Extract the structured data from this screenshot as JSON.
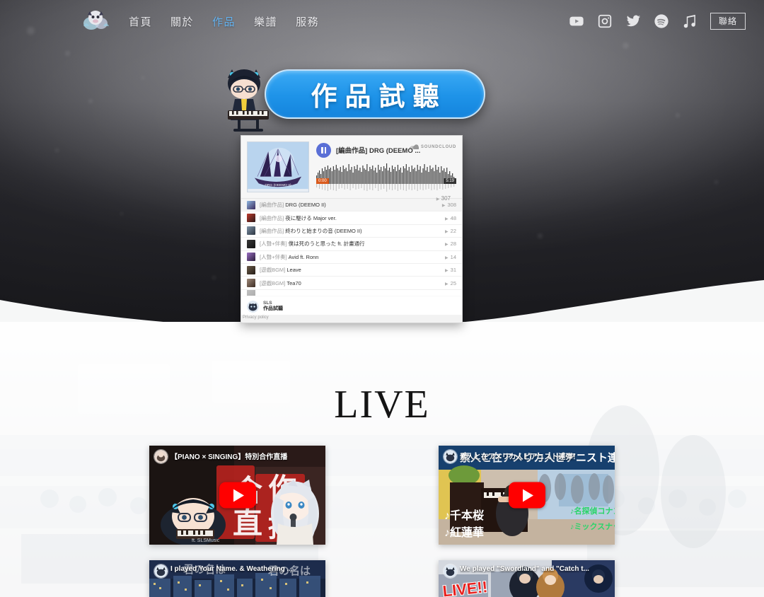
{
  "nav": {
    "logo_alt": "SLS logo",
    "links": [
      {
        "label": "首頁",
        "active": false
      },
      {
        "label": "關於",
        "active": false
      },
      {
        "label": "作品",
        "active": true
      },
      {
        "label": "樂譜",
        "active": false
      },
      {
        "label": "服務",
        "active": false
      }
    ],
    "socials": [
      {
        "name": "youtube-icon"
      },
      {
        "name": "instagram-icon"
      },
      {
        "name": "twitter-icon"
      },
      {
        "name": "spotify-icon"
      },
      {
        "name": "music-note-icon"
      }
    ],
    "contact_label": "聯絡"
  },
  "banner": {
    "title": "作品試聽",
    "color": "#1e93e8"
  },
  "player": {
    "current_title": "[編曲作品] DRG (DEEMO ...",
    "brand": "SOUNDCLOUD",
    "time_start": "0:00",
    "time_end": "5:19",
    "header_plays": "307",
    "tracks": [
      {
        "tag": "[編曲作品]",
        "name": "DRG (DEEMO II)",
        "plays": "308",
        "current": true
      },
      {
        "tag": "[編曲作品]",
        "name": "夜に駆ける Major ver.",
        "plays": "48",
        "current": false
      },
      {
        "tag": "[編曲作品]",
        "name": "終わりと始まりの音 (DEEMO II)",
        "plays": "22",
        "current": false
      },
      {
        "tag": "[人聲+伴奏]",
        "name": "僕は死のうと思った ft. 計畫通行",
        "plays": "28",
        "current": false
      },
      {
        "tag": "[人聲+伴奏]",
        "name": "Avid ft. Ronn",
        "plays": "14",
        "current": false
      },
      {
        "tag": "[遊戲BGM]",
        "name": "Leave",
        "plays": "31",
        "current": false
      },
      {
        "tag": "[遊戲BGM]",
        "name": "Tea70",
        "plays": "25",
        "current": false
      }
    ],
    "footer_user": "SLS",
    "footer_set": "作品試聽",
    "privacy": "Privacy policy"
  },
  "live": {
    "heading": "LIVE",
    "videos": [
      {
        "title": "【PIANO × SINGING】特別合作直播",
        "overlay": "合作直播",
        "channel": "ft. SLSMusic"
      },
      {
        "title": "素人と在アメリカ人ピアニスト連弾！",
        "overlay": "千本桜 / 紅蓮華",
        "channel": "名探偵コナン / ミックスナッツ"
      },
      {
        "title": "I played Your Name. & Weathering ...",
        "overlay": "君の名は",
        "channel": ""
      },
      {
        "title": "We played \"Swordland\" and \"Catch t...",
        "overlay": "LIVE!!",
        "channel": ""
      }
    ]
  }
}
